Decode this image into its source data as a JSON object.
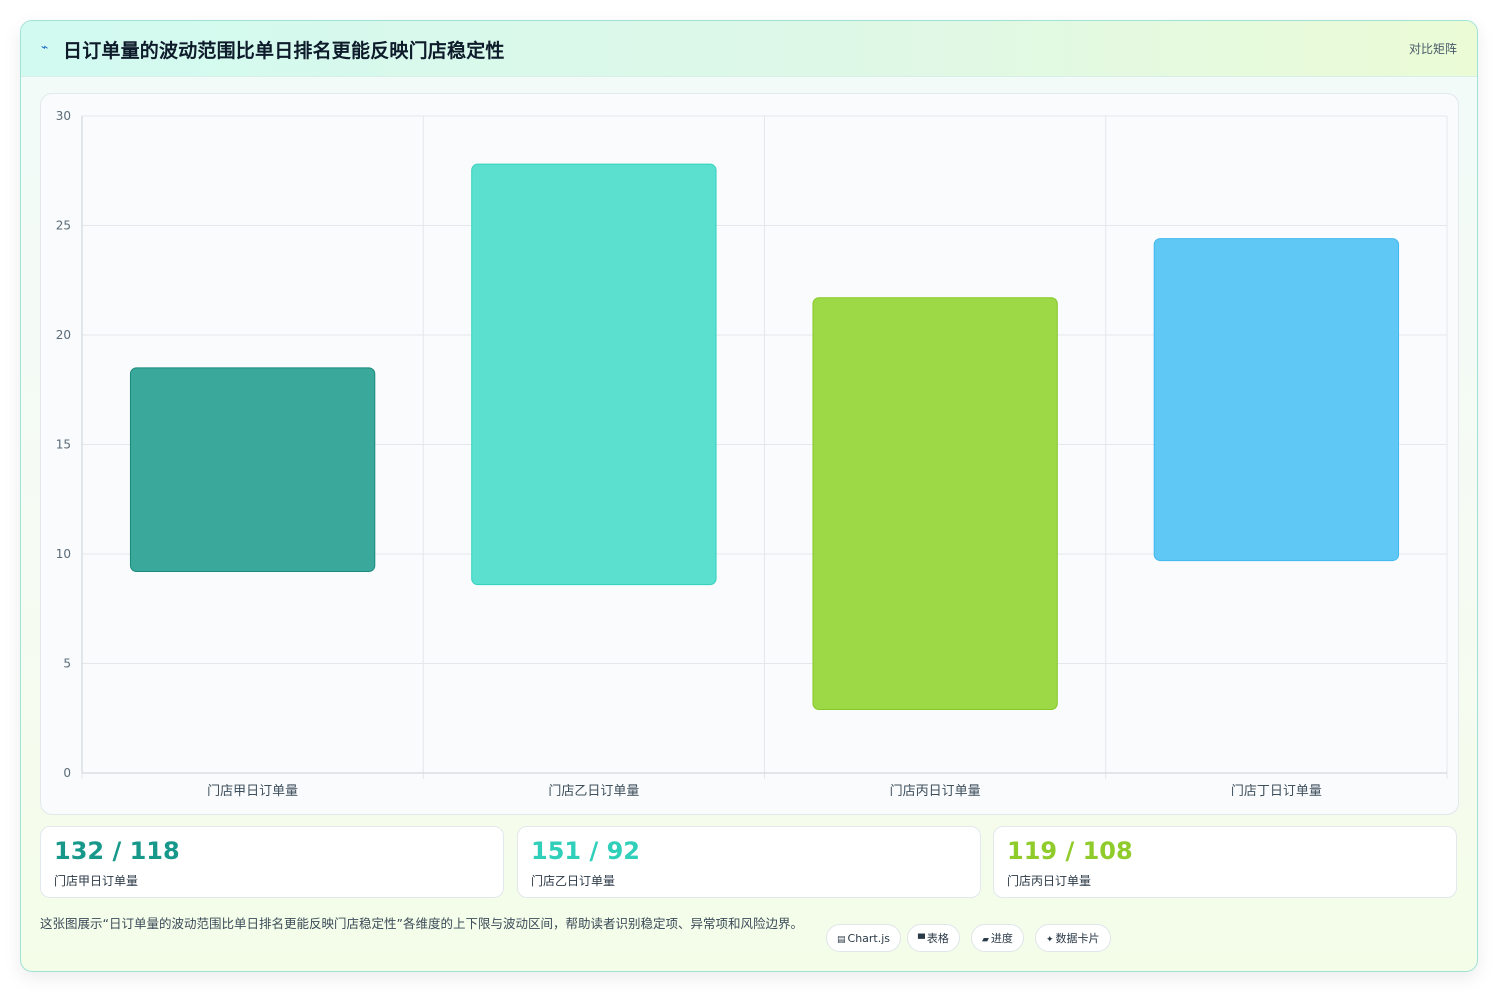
{
  "header": {
    "icon": "sparkline-icon",
    "title": "日订单量的波动范围比单日排名更能反映门店稳定性",
    "action_label": "对比矩阵"
  },
  "chart_data": {
    "type": "bar",
    "subtype": "floating-range",
    "title": "",
    "xlabel": "",
    "ylabel": "",
    "categories": [
      "门店甲日订单量",
      "门店乙日订单量",
      "门店丙日订单量",
      "门店丁日订单量"
    ],
    "ranges": [
      [
        9.2,
        18.5
      ],
      [
        8.6,
        27.8
      ],
      [
        2.9,
        21.7
      ],
      [
        9.7,
        24.4
      ]
    ],
    "colors": [
      "#3ba89c",
      "#5be0d0",
      "#9dd846",
      "#60c8f5"
    ],
    "border_colors": [
      "#1a8a7c",
      "#34d1bd",
      "#85c928",
      "#42b8ef"
    ],
    "ylim": [
      0,
      30
    ],
    "yticks": [
      "0",
      "5",
      "10",
      "15",
      "20",
      "25",
      "30"
    ],
    "grid": true,
    "legend": "none"
  },
  "stats": [
    {
      "value": "132 / 118",
      "label": "门店甲日订单量",
      "color": "#17988a"
    },
    {
      "value": "151 / 92",
      "label": "门店乙日订单量",
      "color": "#2fcfb9"
    },
    {
      "value": "119 / 108",
      "label": "门店丙日订单量",
      "color": "#8fcb2a"
    }
  ],
  "footer": {
    "description": "这张图展示“日订单量的波动范围比单日排名更能反映门店稳定性”各维度的上下限与波动区间，帮助读者识别稳定项、异常项和风险边界。",
    "pills": [
      {
        "icon": "▤",
        "label": "Chart.js"
      },
      {
        "icon": "▀",
        "label": "表格"
      },
      {
        "icon": "▰",
        "label": "进度"
      },
      {
        "icon": "✦",
        "label": "数据卡片"
      }
    ]
  }
}
